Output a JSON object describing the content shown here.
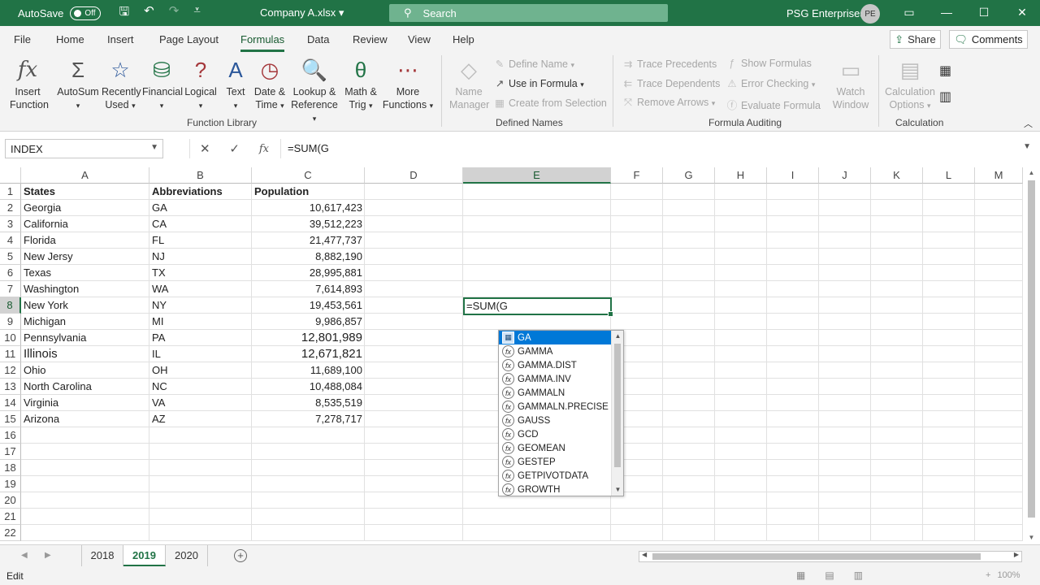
{
  "titlebar": {
    "autosave_label": "AutoSave",
    "autosave_state": "Off",
    "file_name": "Company A.xlsx",
    "search_placeholder": "Search",
    "user_name": "PSG Enterprises",
    "user_initials": "PE"
  },
  "tabs": [
    "File",
    "Home",
    "Insert",
    "Page Layout",
    "Formulas",
    "Data",
    "Review",
    "View",
    "Help"
  ],
  "active_tab": "Formulas",
  "share_label": "Share",
  "comments_label": "Comments",
  "ribbon": {
    "function_library": {
      "label": "Function Library",
      "insert_function": [
        "Insert",
        "Function"
      ],
      "autosum": "AutoSum",
      "recently_used": [
        "Recently",
        "Used"
      ],
      "financial": "Financial",
      "logical": "Logical",
      "text": "Text",
      "date_time": [
        "Date &",
        "Time"
      ],
      "lookup_reference": [
        "Lookup &",
        "Reference"
      ],
      "math_trig": [
        "Math &",
        "Trig"
      ],
      "more_functions": [
        "More",
        "Functions"
      ]
    },
    "defined_names": {
      "label": "Defined Names",
      "name_manager": [
        "Name",
        "Manager"
      ],
      "define_name": "Define Name",
      "use_in_formula": "Use in Formula",
      "create_from_selection": "Create from Selection"
    },
    "formula_auditing": {
      "label": "Formula Auditing",
      "trace_precedents": "Trace Precedents",
      "trace_dependents": "Trace Dependents",
      "remove_arrows": "Remove Arrows",
      "show_formulas": "Show Formulas",
      "error_checking": "Error Checking",
      "evaluate_formula": "Evaluate Formula",
      "watch_window": [
        "Watch",
        "Window"
      ]
    },
    "calculation": {
      "label": "Calculation",
      "calculation_options": [
        "Calculation",
        "Options"
      ]
    }
  },
  "formula_bar": {
    "name_box": "INDEX",
    "formula": "=SUM(G"
  },
  "columns": [
    "A",
    "B",
    "C",
    "D",
    "E",
    "F",
    "G",
    "H",
    "I",
    "J",
    "K",
    "L",
    "M"
  ],
  "rows": [
    "1",
    "2",
    "3",
    "4",
    "5",
    "6",
    "7",
    "8",
    "9",
    "10",
    "11",
    "12",
    "13",
    "14",
    "15",
    "16",
    "17",
    "18",
    "19",
    "20",
    "21",
    "22"
  ],
  "table": {
    "headers": [
      "States",
      "Abbreviations",
      "Population"
    ],
    "data": [
      [
        "Georgia",
        "GA",
        "10,617,423"
      ],
      [
        "California",
        "CA",
        "39,512,223"
      ],
      [
        "Florida",
        "FL",
        "21,477,737"
      ],
      [
        "New Jersy",
        "NJ",
        "8,882,190"
      ],
      [
        "Texas",
        "TX",
        "28,995,881"
      ],
      [
        "Washington",
        "WA",
        "7,614,893"
      ],
      [
        "New York",
        "NY",
        "19,453,561"
      ],
      [
        "Michigan",
        "MI",
        "9,986,857"
      ],
      [
        "Pennsylvania",
        "PA",
        "12,801,989"
      ],
      [
        "Illinois",
        "IL",
        "12,671,821"
      ],
      [
        "Ohio",
        "OH",
        "11,689,100"
      ],
      [
        "North Carolina",
        "NC",
        "10,488,084"
      ],
      [
        "Virginia",
        "VA",
        "8,535,519"
      ],
      [
        "Arizona",
        "AZ",
        "7,278,717"
      ]
    ]
  },
  "active_cell_value": "=SUM(G",
  "autocomplete": [
    "GA",
    "GAMMA",
    "GAMMA.DIST",
    "GAMMA.INV",
    "GAMMALN",
    "GAMMALN.PRECISE",
    "GAUSS",
    "GCD",
    "GEOMEAN",
    "GESTEP",
    "GETPIVOTDATA",
    "GROWTH"
  ],
  "sheets": [
    "2018",
    "2019",
    "2020"
  ],
  "active_sheet": "2019",
  "status": {
    "mode": "Edit",
    "zoom": "100%"
  },
  "colors": {
    "accent": "#217346",
    "highlight": "#0078d7"
  }
}
